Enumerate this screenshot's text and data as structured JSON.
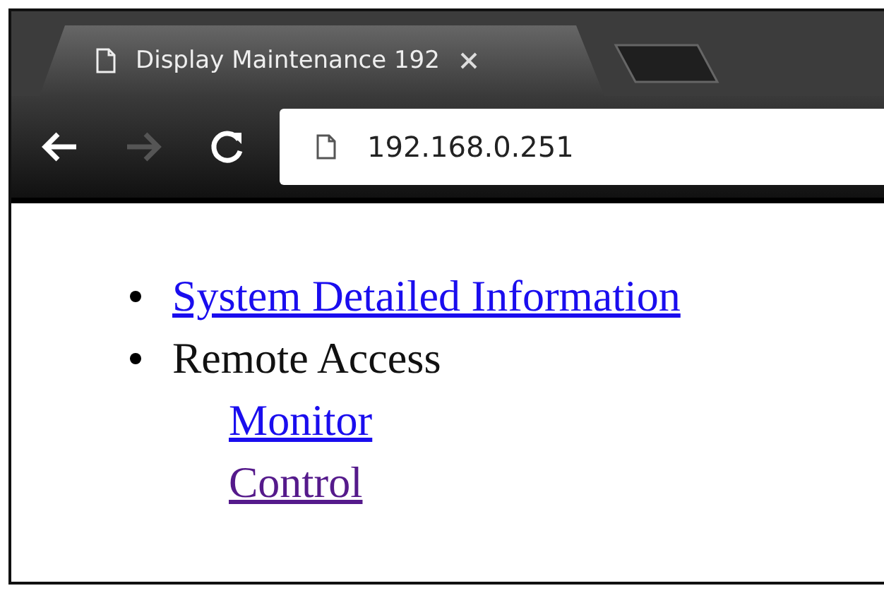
{
  "tab": {
    "title": "Display Maintenance 192",
    "selected": true
  },
  "address_bar": {
    "url": "192.168.0.251"
  },
  "toolbar": {
    "back_disabled": false,
    "forward_disabled": true
  },
  "items": [
    {
      "kind": "link",
      "label": "System Detailed Information",
      "visited": false
    },
    {
      "kind": "text",
      "label": "Remote Access",
      "children": [
        {
          "kind": "link",
          "label": "Monitor",
          "visited": false
        },
        {
          "kind": "link",
          "label": "Control",
          "visited": true
        }
      ]
    }
  ]
}
